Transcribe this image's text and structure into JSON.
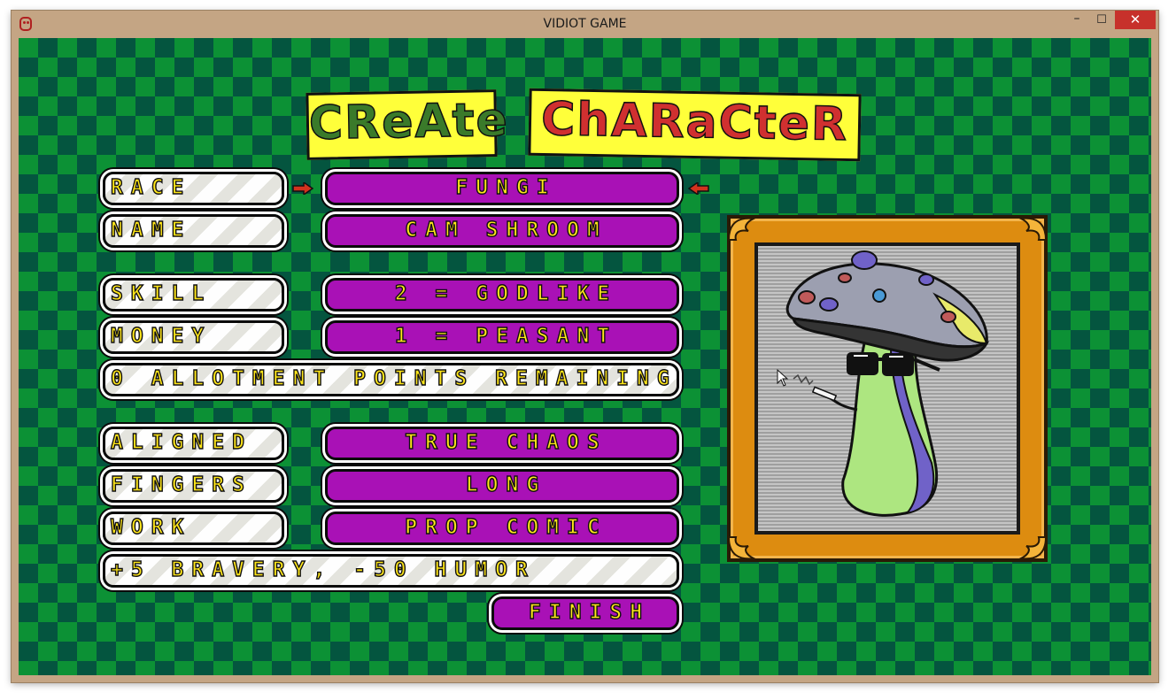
{
  "window": {
    "title": "VIDIOT GAME",
    "controls": {
      "minimize": "–",
      "maximize": "☐",
      "close": "✕"
    }
  },
  "screen": {
    "title_words": [
      "CReAte",
      "ChARaCteR"
    ],
    "rows": [
      {
        "label": "RACE",
        "value": "FUNGI"
      },
      {
        "label": "NAME",
        "value": "CAM SHROOM"
      },
      {
        "label": "SKILL",
        "value": "2 = GODLIKE"
      },
      {
        "label": "MONEY",
        "value": "1 = PEASANT"
      },
      {
        "label": "ALIGNED",
        "value": "TRUE CHAOS"
      },
      {
        "label": "FINGERS",
        "value": "LONG"
      },
      {
        "label": "WORK",
        "value": "PROP COMIC"
      }
    ],
    "allotment_text": "0 ALLOTMENT POINTS REMAINING",
    "work_bonus_text": "+5 BRAVERY, -50 HUMOR",
    "finish_label": "FINISH",
    "portrait_icon": "fungi-character-portrait",
    "colors": {
      "value_pill": "#a911b6",
      "text_yellow": "#ffe61a",
      "arrow_red": "#d2321e",
      "frame_gold": "#dd8c10"
    }
  }
}
